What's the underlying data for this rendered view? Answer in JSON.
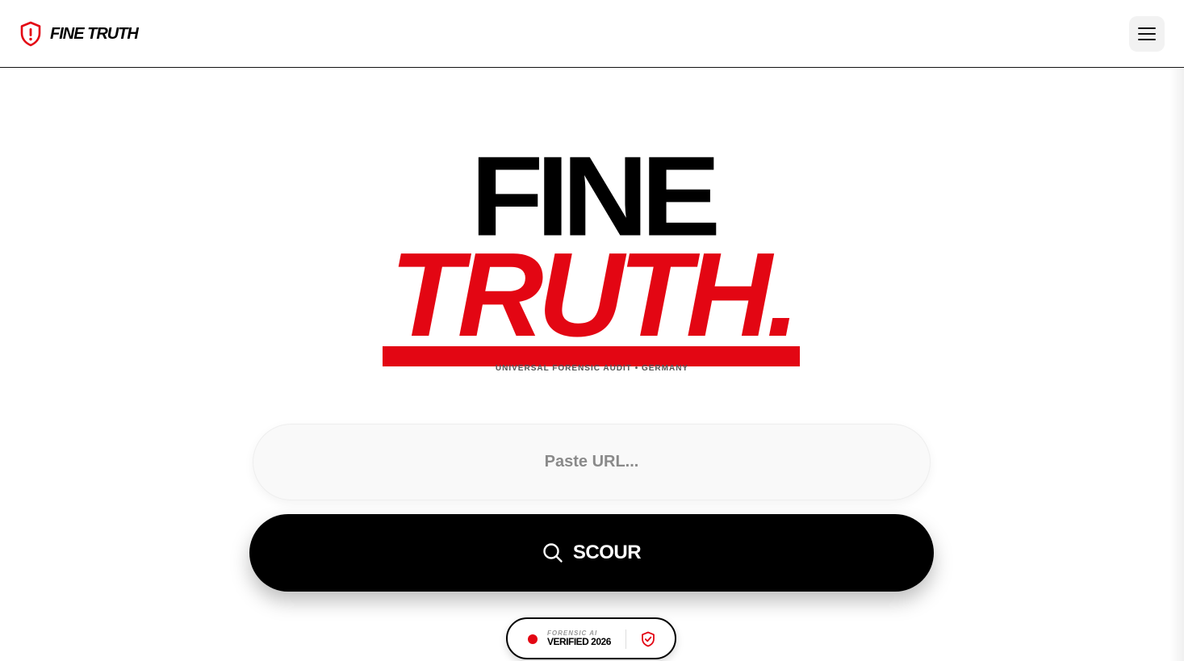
{
  "header": {
    "brand_name": "FINE TRUTH",
    "logo_icon": "shield-alert-icon",
    "menu_icon": "hamburger-menu-icon"
  },
  "hero": {
    "title_line1": "FINE",
    "title_line2": "TRUTH.",
    "tagline": "UNIVERSAL FORENSIC AUDIT • GERMANY"
  },
  "search": {
    "placeholder": "Paste URL...",
    "value": "",
    "button_label": "SCOUR",
    "button_icon": "search-icon"
  },
  "badge": {
    "small_label": "FORENSIC AI",
    "main_label": "VERIFIED 2026",
    "status_icon": "status-dot-icon",
    "shield_icon": "shield-check-icon"
  },
  "colors": {
    "accent": "#e30613",
    "text": "#000000",
    "background": "#ffffff"
  }
}
